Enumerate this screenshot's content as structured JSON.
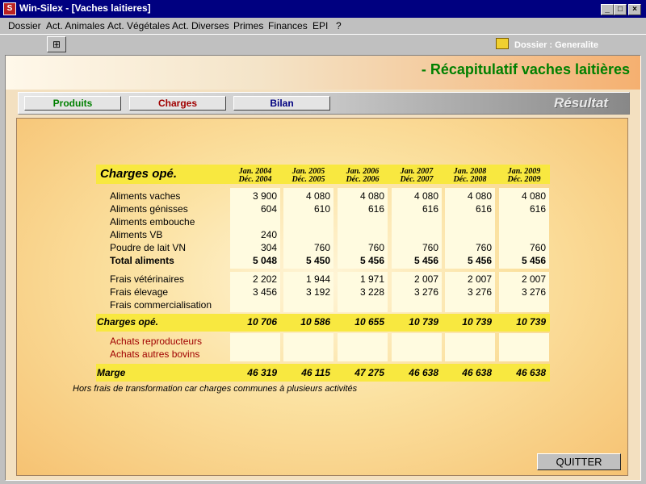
{
  "window": {
    "title": "Win-Silex - [Vaches laitieres]",
    "controls": [
      "_",
      "□",
      "×"
    ]
  },
  "menu": [
    "Dossier",
    "Act. Animales",
    "Act. Végétales",
    "Act. Diverses",
    "Primes",
    "Finances",
    "EPI",
    "?"
  ],
  "toolbar": {
    "dossier_label": "Dossier : Generalite"
  },
  "page_title": "- Récapitulatif vaches laitières",
  "tabs": [
    {
      "label": "Produits",
      "color": "#008000"
    },
    {
      "label": "Charges",
      "color": "#a00000"
    },
    {
      "label": "Bilan",
      "color": "#000080"
    }
  ],
  "resultat_label": "Résultat",
  "table": {
    "title": "Charges opé.",
    "periods": [
      {
        "line1": "Jan. 2004",
        "line2": "Déc. 2004"
      },
      {
        "line1": "Jan. 2005",
        "line2": "Déc. 2005"
      },
      {
        "line1": "Jan. 2006",
        "line2": "Déc. 2006"
      },
      {
        "line1": "Jan. 2007",
        "line2": "Déc. 2007"
      },
      {
        "line1": "Jan. 2008",
        "line2": "Déc. 2008"
      },
      {
        "line1": "Jan. 2009",
        "line2": "Déc. 2009"
      }
    ],
    "group1": [
      {
        "label": "Aliments vaches",
        "values": [
          "3 900",
          "4 080",
          "4 080",
          "4 080",
          "4 080",
          "4 080"
        ]
      },
      {
        "label": "Aliments génisses",
        "values": [
          "604",
          "610",
          "616",
          "616",
          "616",
          "616"
        ]
      },
      {
        "label": "Aliments embouche",
        "values": [
          "",
          "",
          "",
          "",
          "",
          ""
        ]
      },
      {
        "label": "Aliments VB",
        "values": [
          "240",
          "",
          "",
          "",
          "",
          ""
        ]
      },
      {
        "label": "Poudre de lait VN",
        "values": [
          "304",
          "760",
          "760",
          "760",
          "760",
          "760"
        ]
      },
      {
        "label": "Total aliments",
        "values": [
          "5 048",
          "5 450",
          "5 456",
          "5 456",
          "5 456",
          "5 456"
        ]
      }
    ],
    "group2": [
      {
        "label": "Frais vétérinaires",
        "values": [
          "2 202",
          "1 944",
          "1 971",
          "2 007",
          "2 007",
          "2 007"
        ]
      },
      {
        "label": "Frais élevage",
        "values": [
          "3 456",
          "3 192",
          "3 228",
          "3 276",
          "3 276",
          "3 276"
        ]
      },
      {
        "label": "Frais commercialisation",
        "values": [
          "",
          "",
          "",
          "",
          "",
          ""
        ]
      }
    ],
    "charges_total": {
      "label": "Charges opé.",
      "values": [
        "10 706",
        "10 586",
        "10 655",
        "10 739",
        "10 739",
        "10 739"
      ]
    },
    "group3": [
      {
        "label": "Achats reproducteurs",
        "values": [
          "",
          "",
          "",
          "",
          "",
          ""
        ]
      },
      {
        "label": "Achats autres bovins",
        "values": [
          "",
          "",
          "",
          "",
          "",
          ""
        ]
      }
    ],
    "marge": {
      "label": "Marge",
      "values": [
        "46 319",
        "46 115",
        "47 275",
        "46 638",
        "46 638",
        "46 638"
      ]
    }
  },
  "footnote": "Hors frais de transformation car charges communes à plusieurs activités",
  "quit_label": "QUITTER"
}
